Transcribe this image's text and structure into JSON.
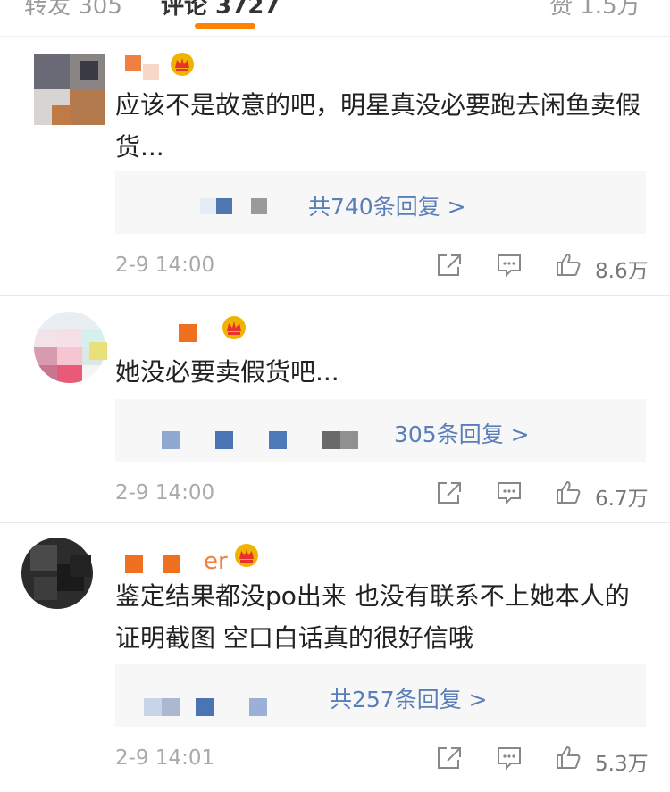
{
  "tabs": {
    "repost": "转发 305",
    "comments": "评论 3727",
    "likes": "赞 1.5万"
  },
  "colors": {
    "accent": "#ff8200",
    "link": "#5a7fb8",
    "badge": "#f0b400"
  },
  "comments": [
    {
      "username_suffix": "",
      "text": "应该不是故意的吧，明星真没必要跑去闲鱼卖假货...",
      "replies": "共740条回复 >",
      "time": "2-9 14:00",
      "likes": "8.6万"
    },
    {
      "username_suffix": "",
      "text": "她没必要卖假货吧...",
      "replies": "305条回复 >",
      "time": "2-9 14:00",
      "likes": "6.7万"
    },
    {
      "username_suffix": "er",
      "text": "鉴定结果都没po出来 也没有联系不上她本人的证明截图 空口白话真的很好信哦",
      "replies": "共257条回复 >",
      "time": "2-9 14:01",
      "likes": "5.3万"
    }
  ]
}
